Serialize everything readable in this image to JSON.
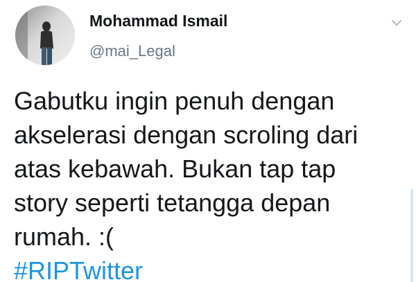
{
  "user": {
    "display_name": "Mohammad Ismail",
    "handle": "@mai_Legal"
  },
  "menu": {
    "icon": "chevron-down-icon"
  },
  "tweet": {
    "lines": [
      "Gabutku ingin penuh dengan",
      "akselerasi dengan scroling dari",
      "atas kebawah. Bukan tap tap",
      "story seperti tetangga depan",
      "rumah. :("
    ],
    "hashtag": "#RIPTwitter"
  },
  "colors": {
    "text": "#14171a",
    "handle": "#657786",
    "link": "#1b95e0",
    "chevron": "#aab8c2"
  }
}
